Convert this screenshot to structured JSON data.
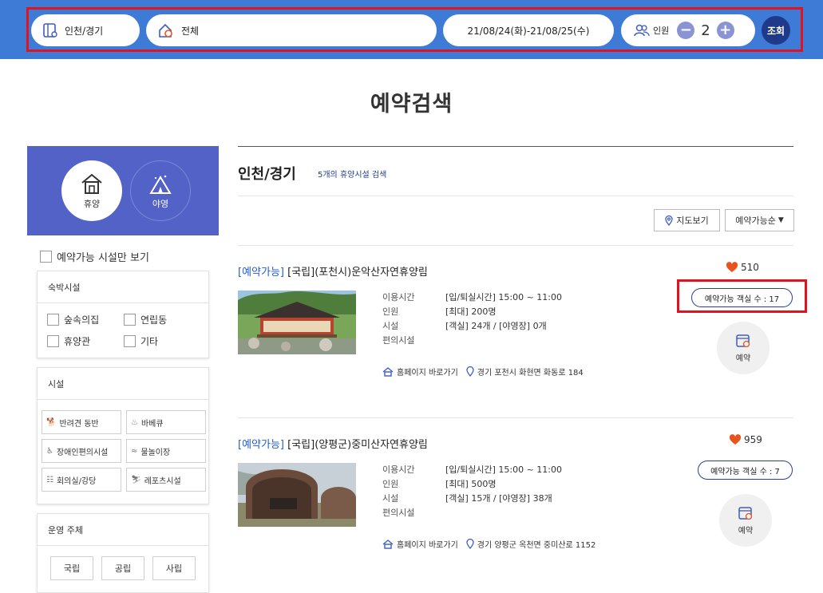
{
  "search_bar": {
    "region": "인천/경기",
    "area": "전체",
    "dates": "21/08/24(화)-21/08/25(수)",
    "people_label": "인원",
    "people_count": "2",
    "minus": "−",
    "plus": "+",
    "search_label": "조회"
  },
  "page_title": "예약검색",
  "sidebar": {
    "categories": [
      {
        "label": "휴양"
      },
      {
        "label": "야영"
      }
    ],
    "available_only": "예약가능 시설만 보기",
    "lodging": {
      "title": "숙박시설",
      "options": [
        "숲속의집",
        "연립동",
        "휴양관",
        "기타"
      ]
    },
    "facilities": {
      "title": "시설",
      "options": [
        "반려견 동반",
        "바베큐",
        "장애인편의시설",
        "물놀이장",
        "회의실/강당",
        "레포츠시설"
      ]
    },
    "operator": {
      "title": "운영 주체",
      "options": [
        "국립",
        "공립",
        "사립"
      ]
    }
  },
  "main": {
    "region_title": "인천/경기",
    "result_count": "5개의 휴양시설 검색",
    "map_button": "지도보기",
    "sort_select": "예약가능순",
    "labels": {
      "time": "이용시간",
      "people": "인원",
      "facility": "시설",
      "amenity": "편의시설",
      "homepage": "홈페이지 바로가기",
      "book": "예약"
    },
    "results": [
      {
        "status": "[예약가능]",
        "name": "[국립](포천시)운악산자연휴양림",
        "likes": "510",
        "rooms": "예약가능 객실 수 : 17",
        "time": "[입/퇴실시간] 15:00 ~ 11:00",
        "people": "[최대] 200명",
        "facility": "[객실] 24개 / [야영장] 0개",
        "address": "경기 포천시 화현면 화동로 184"
      },
      {
        "status": "[예약가능]",
        "name": "[국립](양평군)중미산자연휴양림",
        "likes": "959",
        "rooms": "예약가능 객실 수 : 7",
        "time": "[입/퇴실시간] 15:00 ~ 11:00",
        "people": "[최대] 500명",
        "facility": "[객실] 15개 / [야영장] 38개",
        "address": "경기 양평군 옥천면 중미산로 1152"
      }
    ]
  },
  "colors": {
    "topbar": "#3d7bd6",
    "sidebar_hero": "#5262c7",
    "highlight": "#e0141e",
    "navy": "#1f3a8a",
    "status_blue": "#1f5dcc",
    "heart": "#e8541e"
  }
}
